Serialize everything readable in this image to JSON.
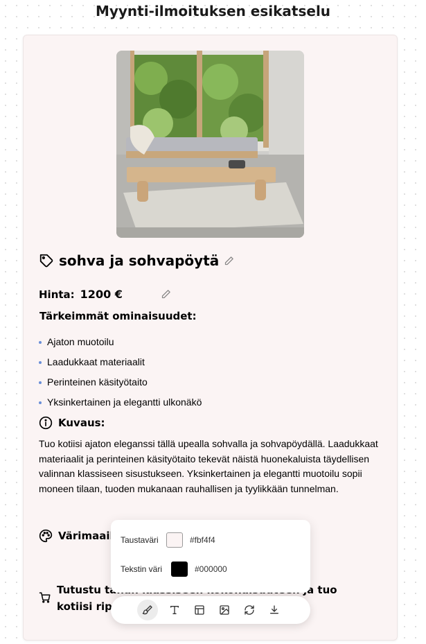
{
  "page": {
    "title": "Myynti-ilmoituksen esikatselu"
  },
  "product": {
    "title": "sohva ja sohvapöytä",
    "price_label": "Hinta:",
    "price": "1200 €",
    "features_heading": "Tärkeimmät ominaisuudet:",
    "features": [
      "Ajaton muotoilu",
      "Laadukkaat materiaalit",
      "Perinteinen käsityötaito",
      "Yksinkertainen ja elegantti ulkonäkö"
    ],
    "description_heading": "Kuvaus:",
    "description": "Tuo kotiisi ajaton eleganssi tällä upealla sohvalla ja sohvapöydällä. Laadukkaat materiaalit ja perinteinen käsityötaito tekevät näistä huonekaluista täydellisen valinnan klassiseen sisustukseen. Yksinkertainen ja elegantti muotoilu sopii moneen tilaan, tuoden mukanaan rauhallisen ja tyylikkään tunnelman.",
    "colors_heading": "Värimaailma",
    "cta_text": "Tutustu tähän klassiseen kokonaisuuteen ja tuo kotiisi ripaus ajatonta tyyliä!"
  },
  "color_popover": {
    "background_label": "Taustaväri",
    "background_value": "#fbf4f4",
    "text_label": "Tekstin väri",
    "text_value": "#000000"
  },
  "toolbar": {
    "tools": [
      "brush-icon",
      "text-icon",
      "layout-icon",
      "image-icon",
      "refresh-icon",
      "download-icon"
    ],
    "active": "brush-icon"
  },
  "colors": {
    "card_background": "#fbf4f4",
    "bullet": "#6a8fd8"
  }
}
